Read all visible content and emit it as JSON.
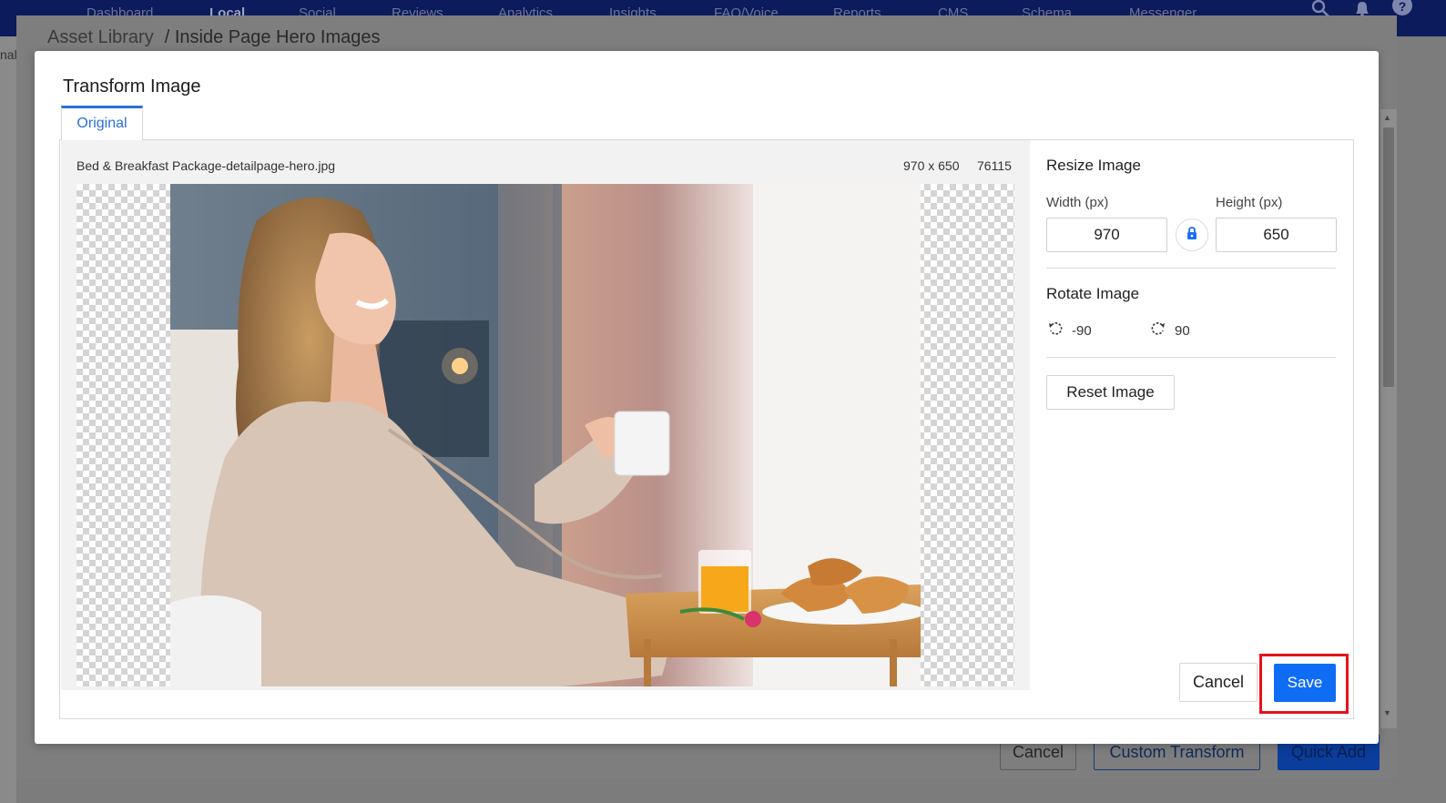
{
  "nav": {
    "items": [
      "Dashboard",
      "Local",
      "Social",
      "Reviews",
      "Analytics",
      "Insights",
      "FAQ/Voice",
      "Reports",
      "CMS",
      "Schema",
      "Messenger"
    ],
    "active": "Local"
  },
  "background": {
    "sidebar_fragment": "nal",
    "breadcrumb": {
      "home": "Asset Library",
      "current": "/ Inside Page Hero Images"
    },
    "buttons": {
      "cancel": "Cancel",
      "custom_transform": "Custom Transform",
      "quick_add": "Quick Add"
    }
  },
  "modal": {
    "title": "Transform Image",
    "tabs": [
      {
        "label": "Original",
        "active": true
      }
    ],
    "image": {
      "file_name": "Bed & Breakfast Package-detailpage-hero.jpg",
      "dimensions": "970 x 650",
      "file_size": "76115"
    },
    "resize": {
      "heading": "Resize Image",
      "width_label": "Width (px)",
      "width_value": "970",
      "height_label": "Height (px)",
      "height_value": "650",
      "lock_icon": "lock-icon"
    },
    "rotate": {
      "heading": "Rotate Image",
      "left_label": "-90",
      "right_label": "90"
    },
    "reset_label": "Reset Image",
    "footer": {
      "cancel_label": "Cancel",
      "save_label": "Save"
    }
  },
  "colors": {
    "accent_blue": "#0f6cf5",
    "tab_blue": "#2b6fd8",
    "highlight_red": "#e8121a",
    "nav_bg": "#0b1b5b"
  }
}
